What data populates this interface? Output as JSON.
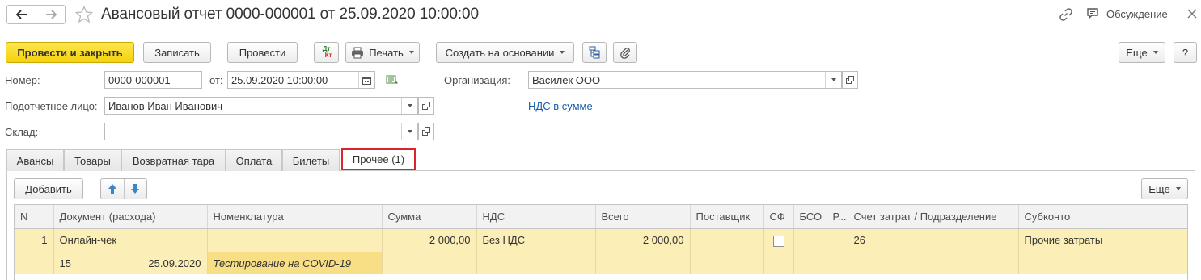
{
  "header": {
    "title": "Авансовый отчет 0000-000001 от 25.09.2020 10:00:00",
    "discuss_label": "Обсуждение"
  },
  "toolbar": {
    "post_close": "Провести и закрыть",
    "save": "Записать",
    "post": "Провести",
    "dt_kt_top": "Дт",
    "dt_kt_bottom": "Кт",
    "print": "Печать",
    "create_based": "Создать на основании",
    "more": "Еще",
    "help": "?"
  },
  "form": {
    "number_label": "Номер:",
    "number_value": "0000-000001",
    "date_label": "от:",
    "date_value": "25.09.2020 10:00:00",
    "org_label": "Организация:",
    "org_value": "Василек ООО",
    "person_label": "Подотчетное лицо:",
    "person_value": "Иванов Иван Иванович",
    "vat_link": "НДС в сумме",
    "warehouse_label": "Склад:",
    "warehouse_value": ""
  },
  "tabs": [
    {
      "label": "Авансы",
      "active": false
    },
    {
      "label": "Товары",
      "active": false
    },
    {
      "label": "Возвратная тара",
      "active": false
    },
    {
      "label": "Оплата",
      "active": false
    },
    {
      "label": "Билеты",
      "active": false
    },
    {
      "label": "Прочее (1)",
      "active": true
    }
  ],
  "panel": {
    "add_label": "Добавить",
    "more_label": "Еще"
  },
  "table": {
    "headers": [
      "N",
      "Документ (расхода)",
      "Номенклатура",
      "Сумма",
      "НДС",
      "Всего",
      "Поставщик",
      "СФ",
      "БСО",
      "Р...",
      "Счет затрат / Подразделение",
      "Субконто"
    ],
    "rows": [
      {
        "n": "1",
        "document": "Онлайн-чек",
        "doc_number": "15",
        "doc_date": "25.09.2020",
        "nomenclature": "Тестирование на COVID-19",
        "sum": "2 000,00",
        "vat": "Без НДС",
        "total": "2 000,00",
        "supplier": "",
        "sf_checked": false,
        "bso": "",
        "r": "",
        "cost_account": "26",
        "subconto": "Прочие затраты"
      }
    ]
  },
  "colors": {
    "primary_button": "#f5d20c",
    "row_highlight": "#fbeeb6",
    "active_tab_border": "#d9262c",
    "link": "#1a5cad"
  }
}
